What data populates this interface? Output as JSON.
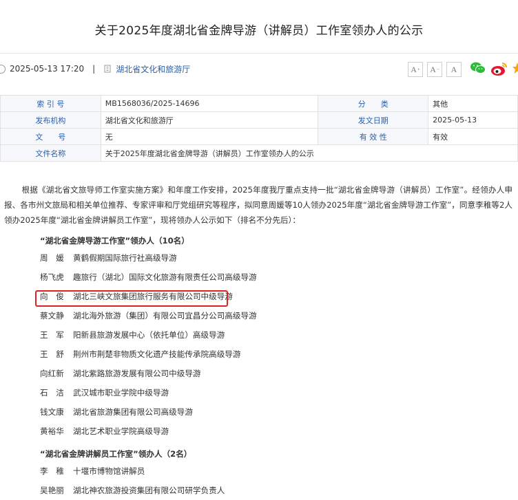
{
  "title": "关于2025年度湖北省金牌导游（讲解员）工作室领办人的公示",
  "meta": {
    "datetime": "2025-05-13 17:20",
    "separator": "|",
    "source": "湖北省文化和旅游厅"
  },
  "font_buttons": [
    "A",
    "A",
    "A"
  ],
  "info_rows": [
    {
      "l1": "索 引 号",
      "v1": "MB1568036/2025-14696",
      "l2": "分　　类",
      "v2": "其他"
    },
    {
      "l1": "发布机构",
      "v1": "湖北省文化和旅游厅",
      "l2": "发文日期",
      "v2": "2025-05-13"
    },
    {
      "l1": "文　　号",
      "v1": "无",
      "l2": "有 效 性",
      "v2": "有效"
    },
    {
      "l1": "文件名称",
      "v1": "关于2025年度湖北省金牌导游（讲解员）工作室领办人的公示"
    }
  ],
  "article": {
    "intro": "根据《湖北省文旅导师工作室实施方案》和年度工作安排，2025年度我厅重点支持一批“湖北省金牌导游（讲解员）工作室”。经领办人申报、各市州文旅局和相关单位推荐、专家评审和厅党组研究等程序，拟同意周媛等10人领办2025年度“湖北省金牌导游工作室”，同意李稚等2人领办2025年度“湖北省金牌讲解员工作室”，现将领办人公示如下（排名不分先后）：",
    "section1_title": "“湖北省金牌导游工作室”领办人（10名）",
    "section1": [
      {
        "name": "周　媛",
        "org": "黄鹤假期国际旅行社高级导游"
      },
      {
        "name": "杨飞虎",
        "org": "趣旅行（湖北）国际文化旅游有限责任公司高级导游"
      },
      {
        "name": "向　俊",
        "org": "湖北三峡文旅集团旅行服务有限公司中级导游"
      },
      {
        "name": "蔡文静",
        "org": "湖北海外旅游（集团）有限公司宜昌分公司高级导游"
      },
      {
        "name": "王　军",
        "org": "阳新县旅游发展中心（依托单位）高级导游"
      },
      {
        "name": "王　舒",
        "org": "荆州市荆楚非物质文化遗产技能传承院高级导游"
      },
      {
        "name": "向红新",
        "org": "湖北紫路旅游发展有限公司中级导游"
      },
      {
        "name": "石　洁",
        "org": "武汉城市职业学院中级导游"
      },
      {
        "name": "钱文康",
        "org": "湖北省旅游集团有限公司高级导游"
      },
      {
        "name": "黄裕华",
        "org": "湖北艺术职业学院高级导游"
      }
    ],
    "section2_title": "“湖北省金牌讲解员工作室”领办人（2名）",
    "section2": [
      {
        "name": "李　稚",
        "org": "十堰市博物馆讲解员"
      },
      {
        "name": "吴艳丽",
        "org": "湖北神农旅游投资集团有限公司研学负责人"
      }
    ]
  },
  "colors": {
    "link": "#2a5fa8",
    "highlight": "#e02020",
    "wechat": "#2dbb3a",
    "weibo": "#e6162d",
    "weibo_accent": "#f7a800"
  }
}
